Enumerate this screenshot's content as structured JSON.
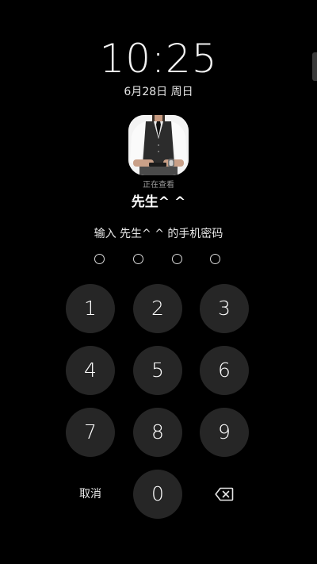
{
  "lock_screen": {
    "time": "10:25",
    "date": "6月28日 周日"
  },
  "profile": {
    "viewing_label": "正在查看",
    "name": "先生^ ^",
    "avatar_icon": "profile-photo"
  },
  "passcode": {
    "prompt": "输入 先生^ ^ 的手机密码",
    "length": 4,
    "entered": 0
  },
  "keypad": {
    "keys": [
      "1",
      "2",
      "3",
      "4",
      "5",
      "6",
      "7",
      "8",
      "9",
      "0"
    ],
    "cancel_label": "取消",
    "delete_icon": "backspace-icon"
  },
  "colors": {
    "background": "#000000",
    "key_fill": "#262626",
    "text": "#ffffff"
  }
}
